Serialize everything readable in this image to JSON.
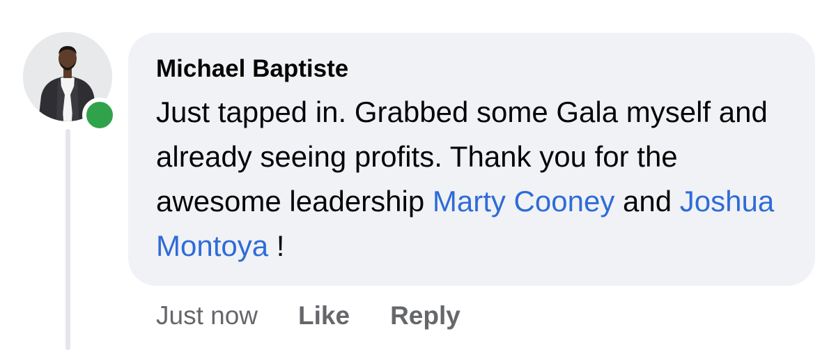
{
  "comment": {
    "author": "Michael Baptiste",
    "text_before": "Just tapped in. Grabbed some Gala myself and already seeing profits. Thank you for the awesome leadership ",
    "mention_1": "Marty Cooney",
    "text_between": " and ",
    "mention_2": "Joshua Montoya",
    "text_after": " !",
    "timestamp": "Just now",
    "like_label": "Like",
    "reply_label": "Reply",
    "author_online": true
  },
  "colors": {
    "bubble_bg": "#f0f2f5",
    "mention": "#2f6bd8",
    "meta_text": "#65676b",
    "online": "#31a24c",
    "thread_line": "#e4e6eb"
  }
}
